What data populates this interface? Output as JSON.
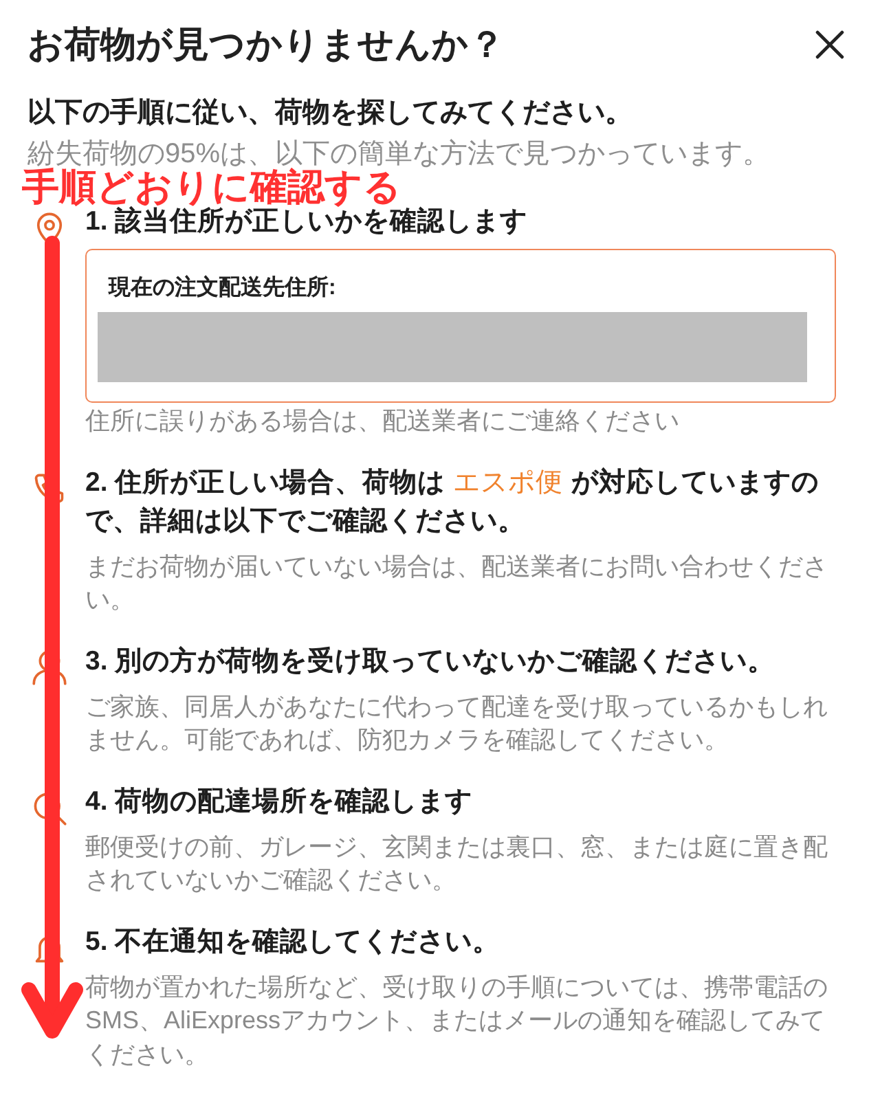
{
  "dialog": {
    "title": "お荷物が見つかりませんか？"
  },
  "intro": "以下の手順に従い、荷物を探してみてください。",
  "subtitle": "紛失荷物の95%は、以下の簡単な方法で見つかっています。",
  "annotation": {
    "text": "手順どおりに確認する"
  },
  "steps": [
    {
      "kind": "address",
      "title": "1. 該当住所が正しいかを確認します",
      "address_label": "現在の注文配送先住所:",
      "hint": "住所に誤りがある場合は、配送業者にご連絡ください"
    },
    {
      "kind": "info",
      "title": "2. 住所が正しい場合、荷物は",
      "link": "エスポ便",
      "title_end": "が対応していますので、詳細は以下でご確認ください。",
      "hint": "まだお荷物が届いていない場合は、配送業者にお問い合わせください。"
    },
    {
      "kind": "info",
      "title": "3. 別の方が荷物を受け取っていないかご確認ください。",
      "hint": "ご家族、同居人があなたに代わって配達を受け取っているかもしれません。可能であれば、防犯カメラを確認してください。"
    },
    {
      "kind": "info",
      "title": "4. 荷物の配達場所を確認します",
      "hint": "郵便受けの前、ガレージ、玄関または裏口、窓、または庭に置き配されていないかご確認ください。"
    },
    {
      "kind": "info",
      "title": "5. 不在通知を確認してください。",
      "hint": "荷物が置かれた場所など、受け取りの手順については、携帯電話のSMS、AliExpressアカウント、またはメールの通知を確認してみてください。"
    }
  ]
}
